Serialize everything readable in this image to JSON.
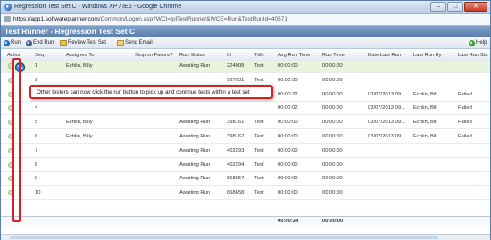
{
  "window": {
    "title": "Regression Test Set C - Windows XP / IE6 - Google Chrome",
    "buttons": [
      "–",
      "□",
      "✕"
    ]
  },
  "address": {
    "host": "https://app1.softwareplanner.com",
    "path": "/Common/Logon.asp?WCI=tplTestRunner&WCE=Run&TestRunId=40571"
  },
  "app": {
    "header": "Test Runner - Regression Test Set C"
  },
  "toolbar": {
    "run": "Run",
    "end_run": "End Run",
    "review": "Review Test Set",
    "email": "Send Email",
    "help": "Help"
  },
  "columns": [
    "Action",
    "Seq",
    "Assigned To",
    "Stop on Failure?",
    "Run Status",
    "Id",
    "Title",
    "Avg Run Time",
    "Run Time",
    "Date Last Run",
    "Last Run By",
    "Last Run Sta"
  ],
  "rows": [
    {
      "seq": "1",
      "assigned": "Echlin, Billy",
      "stop": "",
      "status": "Awaiting Run",
      "id": "224008",
      "title": "Test",
      "avg": "00:00:00",
      "run": "00:00:00",
      "date": "",
      "by": "",
      "last": ""
    },
    {
      "seq": "2",
      "assigned": "",
      "stop": "",
      "status": "",
      "id": "567931",
      "title": "Test",
      "avg": "00:00:00",
      "run": "00:00:00",
      "date": "",
      "by": "",
      "last": ""
    },
    {
      "seq": "3",
      "assigned": "",
      "stop": "",
      "status": "",
      "id": "",
      "title": "",
      "avg": "00:00:22",
      "run": "00:00:00",
      "date": "03/07/2013 09...",
      "by": "Echlin, Bill",
      "last": "Failed"
    },
    {
      "seq": "4",
      "assigned": "",
      "stop": "",
      "status": "",
      "id": "",
      "title": "",
      "avg": "00:00:02",
      "run": "00:00:00",
      "date": "03/07/2013 09...",
      "by": "Echlin, Bill",
      "last": "Failed"
    },
    {
      "seq": "5",
      "assigned": "Echlin, Billy",
      "stop": "",
      "status": "Awaiting Run",
      "id": "398161",
      "title": "Test",
      "avg": "00:00:00",
      "run": "00:00:00",
      "date": "03/07/2013 09...",
      "by": "Echlin, Bill",
      "last": "Failed"
    },
    {
      "seq": "6",
      "assigned": "Echlin, Billy",
      "stop": "",
      "status": "Awaiting Run",
      "id": "398162",
      "title": "Test",
      "avg": "00:00:00",
      "run": "00:00:00",
      "date": "03/07/2013 09...",
      "by": "Echlin, Bill",
      "last": "Failed"
    },
    {
      "seq": "7",
      "assigned": "",
      "stop": "",
      "status": "Awaiting Run",
      "id": "402293",
      "title": "Test",
      "avg": "00:00:00",
      "run": "00:00:00",
      "date": "",
      "by": "",
      "last": ""
    },
    {
      "seq": "8",
      "assigned": "",
      "stop": "",
      "status": "Awaiting Run",
      "id": "402294",
      "title": "Test",
      "avg": "00:00:00",
      "run": "00:00:00",
      "date": "",
      "by": "",
      "last": ""
    },
    {
      "seq": "9",
      "assigned": "",
      "stop": "",
      "status": "Awaiting Run",
      "id": "868657",
      "title": "Test",
      "avg": "00:00:00",
      "run": "00:00:00",
      "date": "",
      "by": "",
      "last": ""
    },
    {
      "seq": "10",
      "assigned": "",
      "stop": "",
      "status": "Awaiting Run",
      "id": "868658",
      "title": "Test",
      "avg": "00:00:00",
      "run": "00:00:00",
      "date": "",
      "by": "",
      "last": ""
    }
  ],
  "footer": {
    "avg": "00:00:24",
    "run": "00:00:00"
  },
  "callout": "Other testers can now click the run button to pick up and continue tests within a test set",
  "colors": {
    "highlight": "#d32222",
    "header": "#5b7fae",
    "selected_row": "#eaf3da"
  }
}
